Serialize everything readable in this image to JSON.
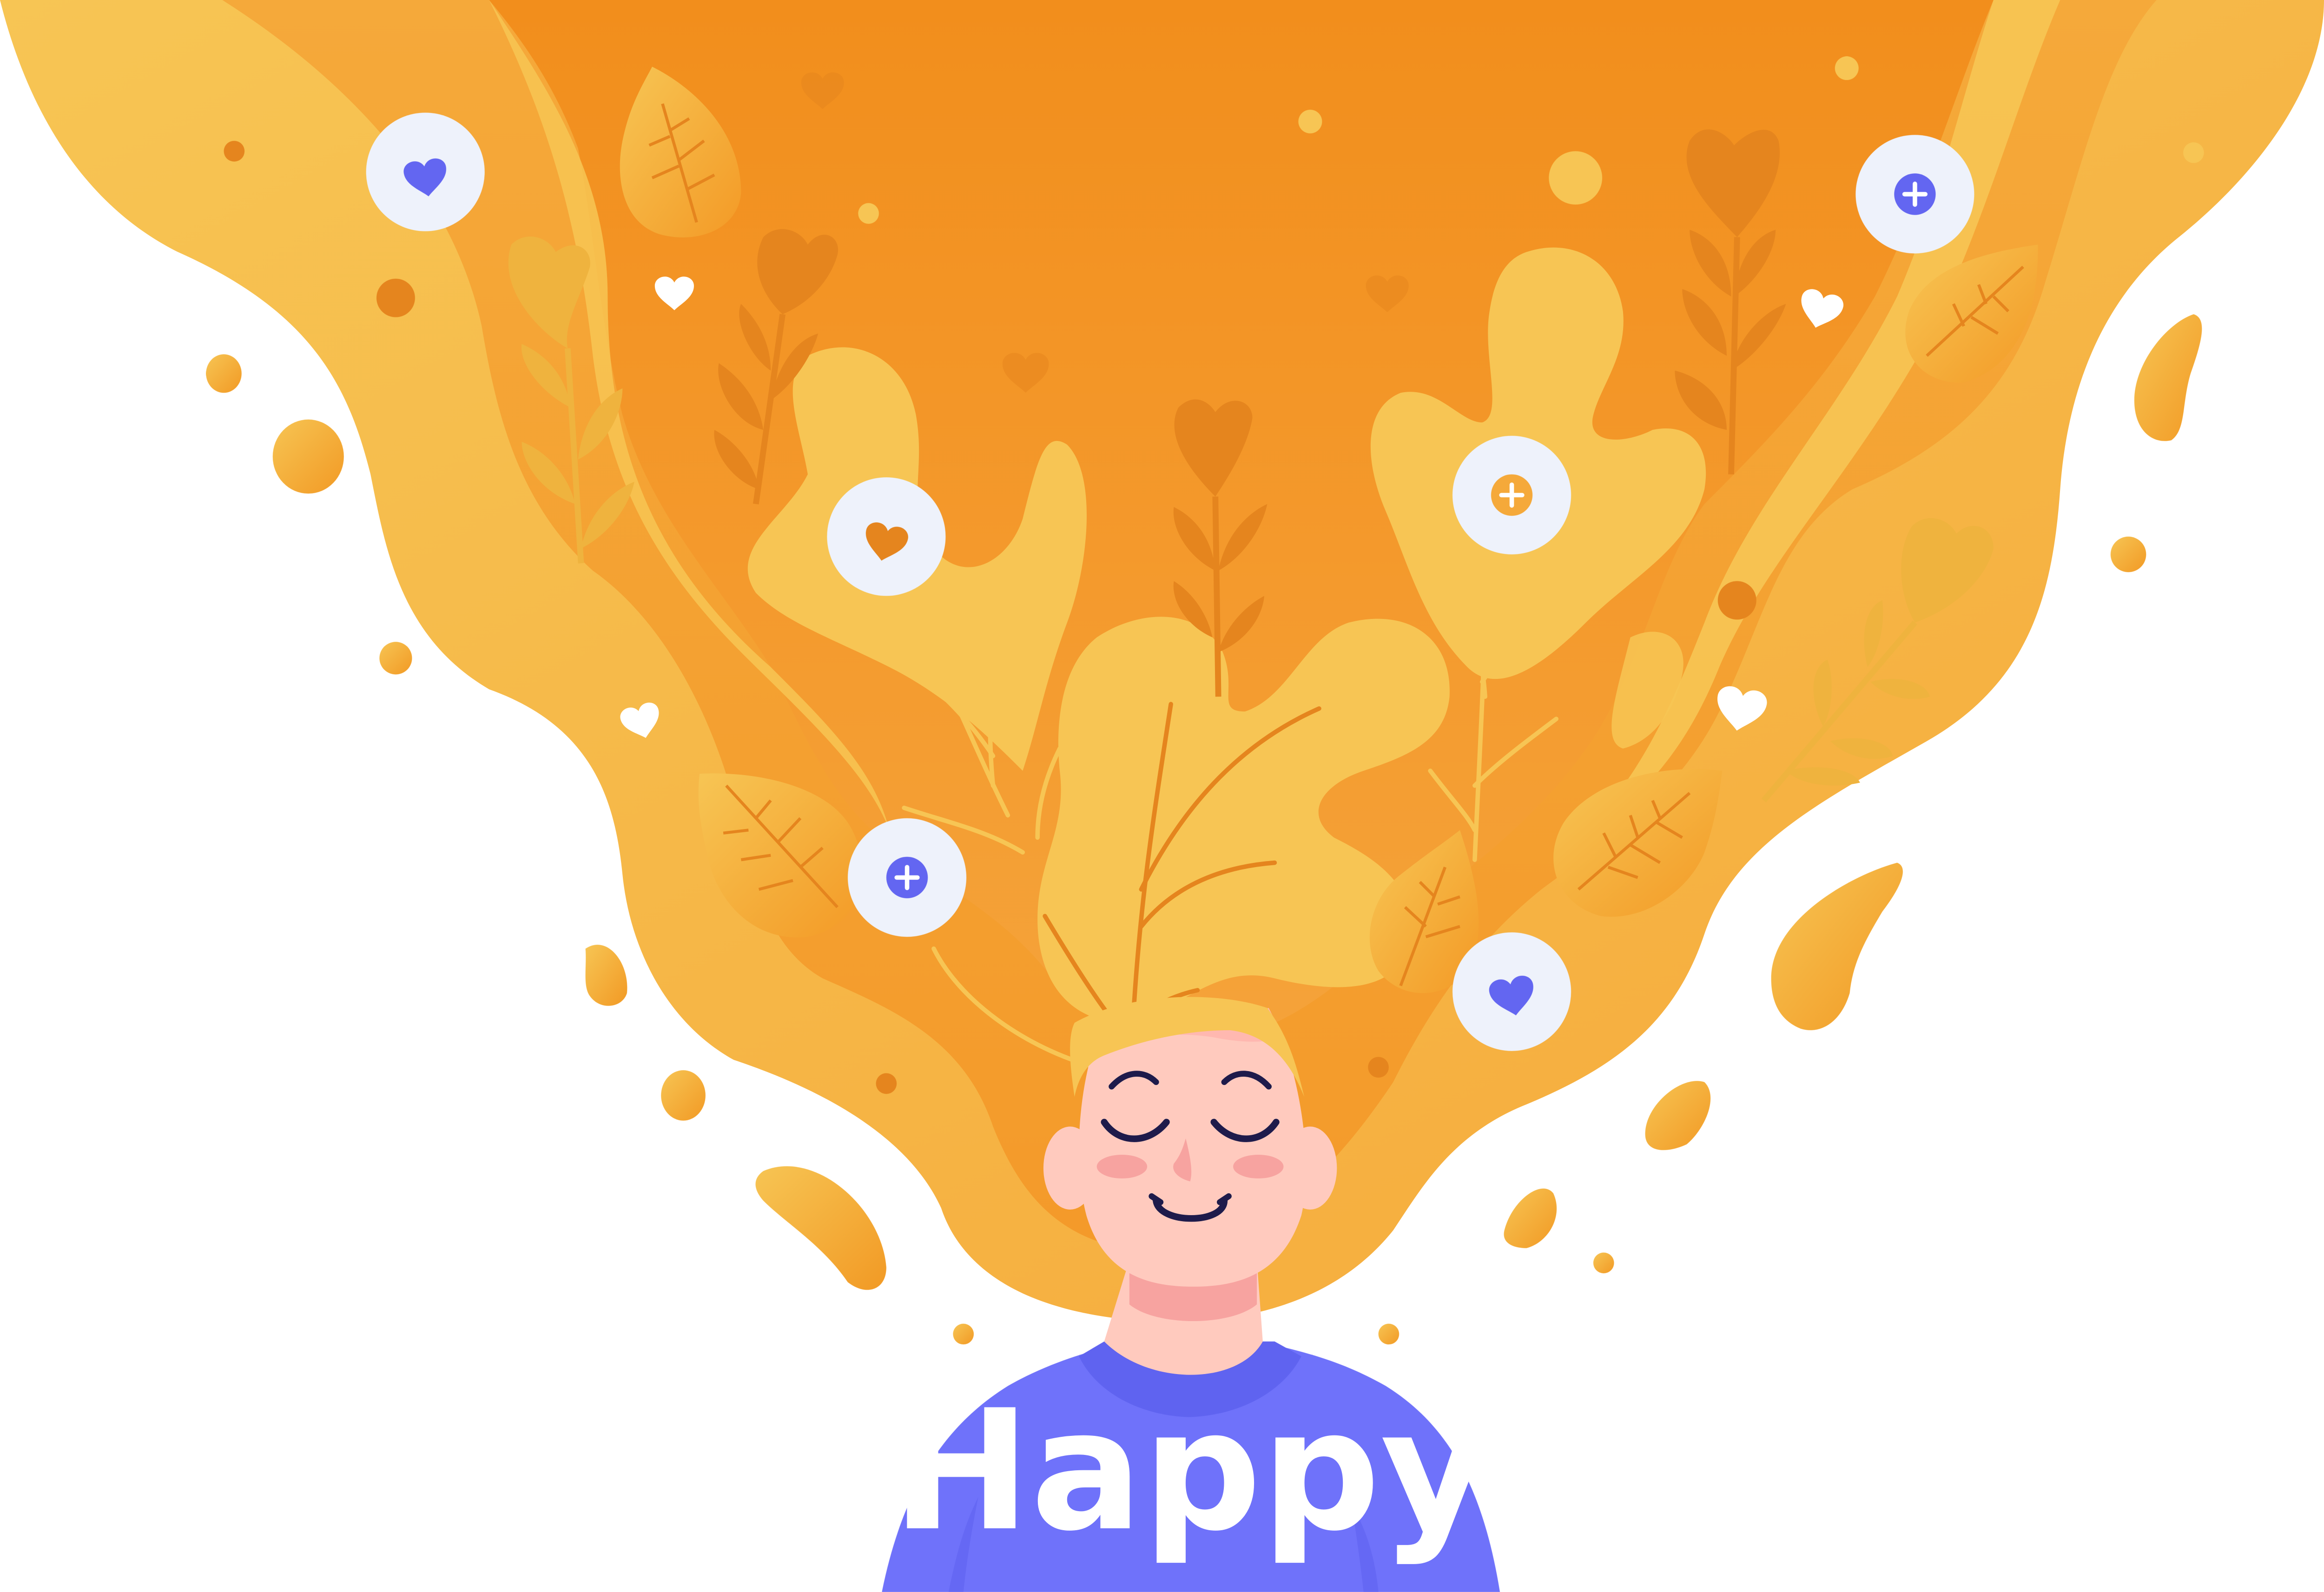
{
  "illustration": {
    "shirt_text": "Happy",
    "colors": {
      "background": "#ffffff",
      "hair_light": "#F7C554",
      "hair_mid": "#F5A93A",
      "hair_dark": "#F28E1C",
      "plant_dark": "#E5851E",
      "skin": "#FFCABE",
      "blush": "#F7A3A0",
      "shirt": "#6F72FA",
      "shirt_collar": "#5F63F0",
      "bubble_fill": "#EEF2FB",
      "icon_purple": "#6366F1",
      "face_lines": "#1E1B4B"
    },
    "icons": [
      "heart-bubble-icon",
      "plus-bubble-icon",
      "heart-icon",
      "leaf-icon",
      "flower-icon",
      "droplet-icon"
    ]
  }
}
